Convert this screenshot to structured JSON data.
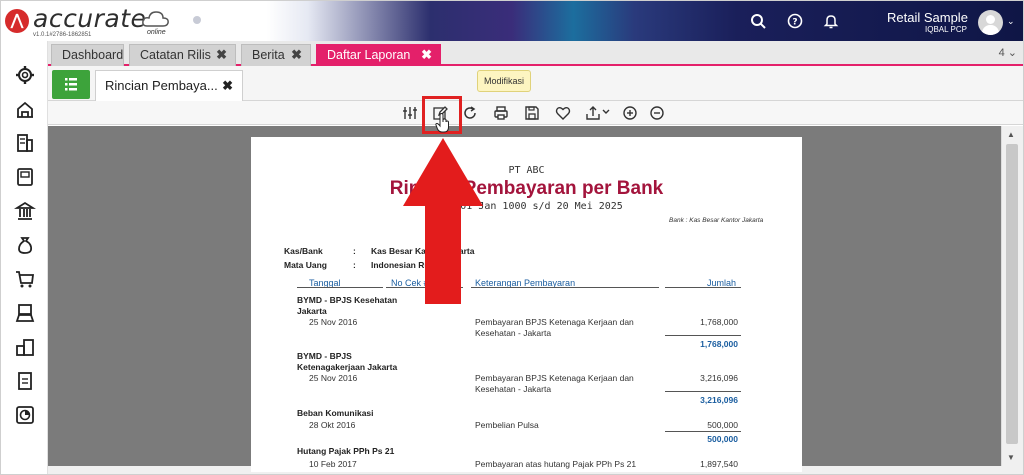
{
  "header": {
    "brand": "accurate",
    "brand_sub": "online",
    "version": "v1.0.1#2786-1862851",
    "user_name": "Retail Sample",
    "company": "IQBAL PCP",
    "icons": [
      "search-icon",
      "help-icon",
      "bell-icon"
    ]
  },
  "tabs": [
    {
      "label": "Dashboard",
      "closable": false,
      "active": false
    },
    {
      "label": "Catatan Rilis",
      "closable": true,
      "active": false
    },
    {
      "label": "Berita",
      "closable": true,
      "active": false
    },
    {
      "label": "Daftar Laporan",
      "closable": true,
      "active": true
    }
  ],
  "tab_close": "✖",
  "tab_count": "4 ⌄",
  "subtab": {
    "label": "Rincian Pembaya...",
    "close": "✖"
  },
  "tooltip": "Modifikasi",
  "toolbar_icons": [
    "filter-icon",
    "edit-icon",
    "refresh-icon",
    "print-icon",
    "save-icon",
    "favorite-icon",
    "export-icon",
    "zoom-in-icon",
    "zoom-out-icon"
  ],
  "report": {
    "company": "PT ABC",
    "title": "Rincian Pembayaran per Bank",
    "period": "Dari 01 Jan 1000 s/d 20 Mei 2025",
    "bank_note": "Bank : Kas Besar Kantor Jakarta",
    "kasbank_label": "Kas/Bank",
    "kasbank_value": "Kas Besar Kantor Jakarta",
    "currency_label": "Mata Uang",
    "currency_value": "Indonesian Rupiah",
    "separator": ":",
    "columns": [
      "Tanggal",
      "No Cek #",
      "Keterangan Pembayaran",
      "Jumlah"
    ],
    "groups": [
      {
        "name": "BYMD - BPJS Kesehatan Jakarta",
        "rows": [
          {
            "date": "25 Nov 2016",
            "desc": "Pembayaran BPJS Ketenaga Kerjaan dan Kesehatan - Jakarta",
            "amount": "1,768,000"
          }
        ],
        "total": "1,768,000"
      },
      {
        "name": "BYMD - BPJS Ketenagakerjaan Jakarta",
        "rows": [
          {
            "date": "25 Nov 2016",
            "desc": "Pembayaran BPJS Ketenaga Kerjaan dan Kesehatan - Jakarta",
            "amount": "3,216,096"
          }
        ],
        "total": "3,216,096"
      },
      {
        "name": "Beban Komunikasi",
        "rows": [
          {
            "date": "28 Okt 2016",
            "desc": "Pembelian Pulsa",
            "amount": "500,000"
          }
        ],
        "total": "500,000"
      },
      {
        "name": "Hutang Pajak PPh Ps 21",
        "rows": [
          {
            "date": "10 Feb 2017",
            "desc": "Pembayaran atas hutang Pajak PPh Ps 21",
            "amount": "1,897,540"
          }
        ],
        "total": ""
      }
    ]
  },
  "colors": {
    "accent": "#e4206a",
    "report_title": "#a3143c",
    "highlight": "#e02121",
    "link_blue": "#1b5ea0"
  }
}
